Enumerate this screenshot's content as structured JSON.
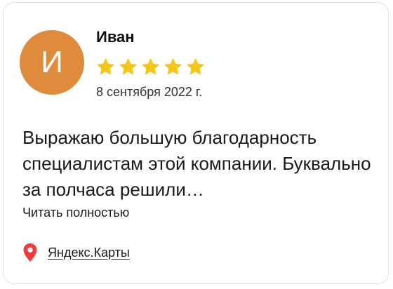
{
  "review": {
    "avatar_initial": "И",
    "avatar_color": "#df8b3c",
    "author": "Иван",
    "rating": 5,
    "rating_max": 5,
    "star_color": "#f5c518",
    "date": "8 сентября 2022 г.",
    "text": "Выражаю большую благодарность специалистам этой компании. Буквально за полчаса решили…",
    "read_more_label": "Читать полностью"
  },
  "source": {
    "icon": "map-pin-icon",
    "icon_color": "#ef3d3d",
    "label": "Яндекс.Карты"
  }
}
